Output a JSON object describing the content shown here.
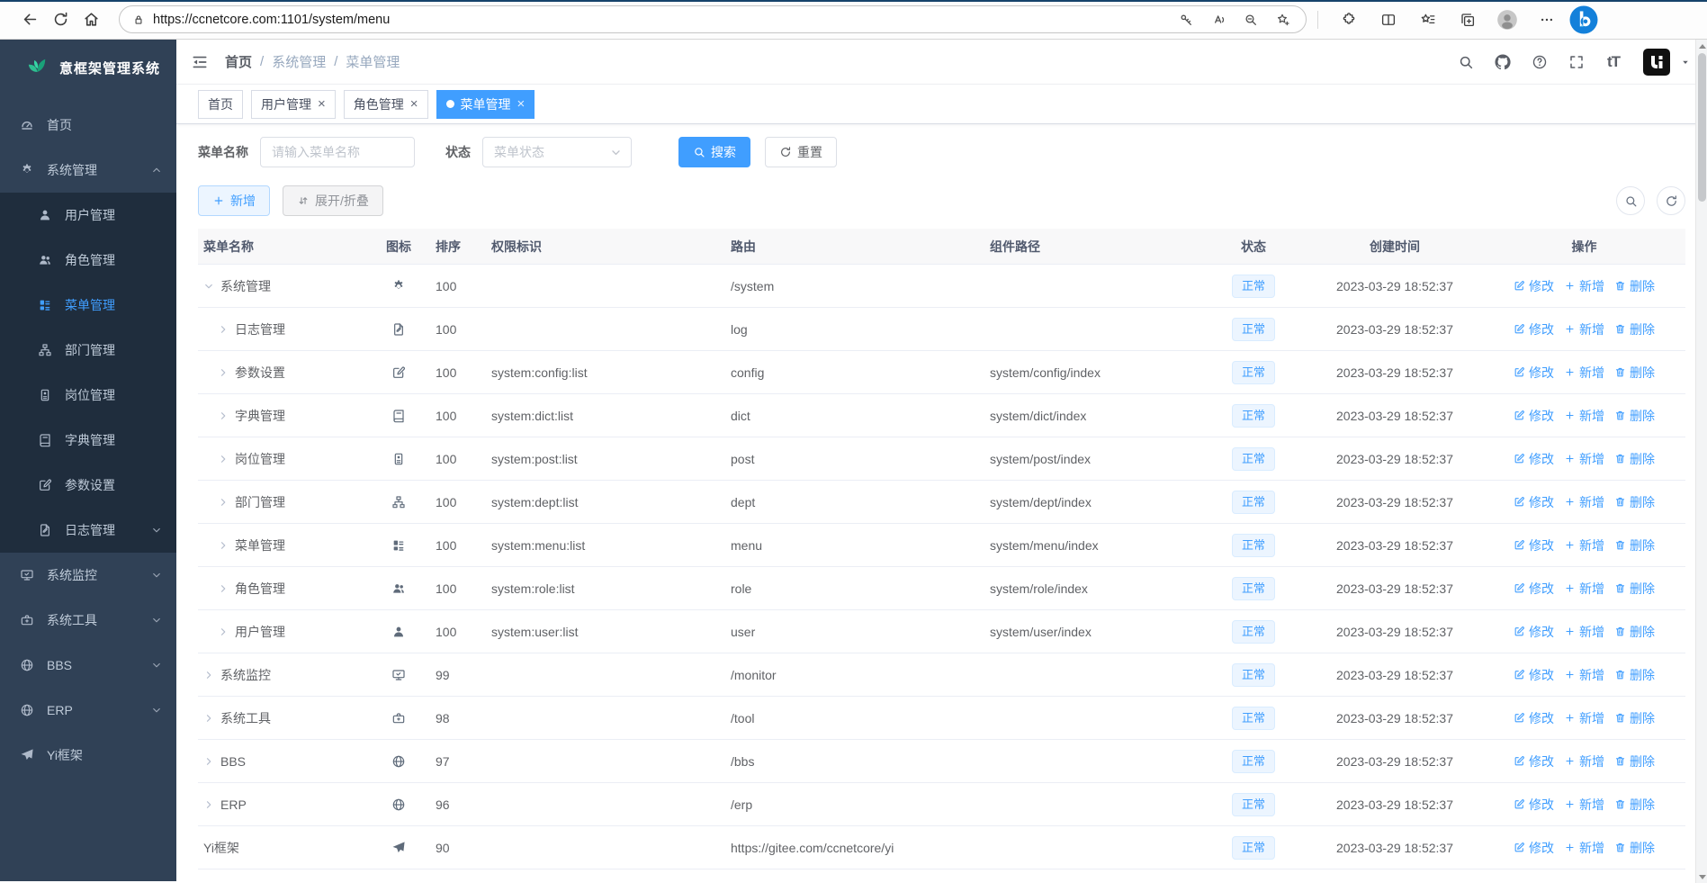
{
  "colors": {
    "accent": "#409eff",
    "sidebar_bg": "#304156",
    "submenu_bg": "#1f2d3d",
    "status_tag_bg": "#ecf5ff",
    "status_tag_text": "#409eff",
    "active_tab_bg": "#409eff"
  },
  "browser": {
    "url": "https://ccnetcore.com:1101/system/menu"
  },
  "navbar": {
    "font_size_glyph": "tT"
  },
  "app": {
    "logo_title": "意框架管理系统",
    "sidebar": {
      "items": [
        {
          "label": "首页",
          "icon": "i-dash"
        },
        {
          "label": "系统管理",
          "icon": "i-gear",
          "chevron": "up"
        },
        {
          "label": "用户管理",
          "icon": "i-user",
          "sub": true
        },
        {
          "label": "角色管理",
          "icon": "i-users",
          "sub": true
        },
        {
          "label": "菜单管理",
          "icon": "i-menu",
          "sub": true,
          "active": true
        },
        {
          "label": "部门管理",
          "icon": "i-tree",
          "sub": true
        },
        {
          "label": "岗位管理",
          "icon": "i-badge",
          "sub": true
        },
        {
          "label": "字典管理",
          "icon": "i-book",
          "sub": true
        },
        {
          "label": "参数设置",
          "icon": "i-pen",
          "sub": true
        },
        {
          "label": "日志管理",
          "icon": "i-doc",
          "sub": true,
          "chevron": "down"
        },
        {
          "label": "系统监控",
          "icon": "i-monitor",
          "chevron": "down"
        },
        {
          "label": "系统工具",
          "icon": "i-tool",
          "chevron": "down"
        },
        {
          "label": "BBS",
          "icon": "i-globe",
          "chevron": "down"
        },
        {
          "label": "ERP",
          "icon": "i-globe",
          "chevron": "down"
        },
        {
          "label": "Yi框架",
          "icon": "i-send"
        }
      ]
    },
    "breadcrumb": {
      "items": [
        "首页",
        "系统管理",
        "菜单管理"
      ],
      "separator": "/"
    },
    "tabs": [
      {
        "label": "首页",
        "closable": false
      },
      {
        "label": "用户管理",
        "closable": true
      },
      {
        "label": "角色管理",
        "closable": true
      },
      {
        "label": "菜单管理",
        "closable": true,
        "active": true
      }
    ],
    "search": {
      "name_label": "菜单名称",
      "name_placeholder": "请输入菜单名称",
      "status_label": "状态",
      "status_placeholder": "菜单状态",
      "search_button": "搜索",
      "reset_button": "重置"
    },
    "toolbar": {
      "add_button": "新增",
      "expand_button": "展开/折叠"
    },
    "table": {
      "headers": [
        "菜单名称",
        "图标",
        "排序",
        "权限标识",
        "路由",
        "组件路径",
        "状态",
        "创建时间",
        "操作"
      ],
      "ops": {
        "edit": "修改",
        "add": "新增",
        "delete": "删除"
      },
      "rows": [
        {
          "name": "系统管理",
          "icon": "i-gear",
          "sort": 100,
          "perm": "",
          "route": "/system",
          "component": "",
          "status": "正常",
          "created": "2023-03-29 18:52:37",
          "level": 0,
          "expand": "down"
        },
        {
          "name": "日志管理",
          "icon": "i-doc",
          "sort": 100,
          "perm": "",
          "route": "log",
          "component": "",
          "status": "正常",
          "created": "2023-03-29 18:52:37",
          "level": 1,
          "expand": "right"
        },
        {
          "name": "参数设置",
          "icon": "i-pen",
          "sort": 100,
          "perm": "system:config:list",
          "route": "config",
          "component": "system/config/index",
          "status": "正常",
          "created": "2023-03-29 18:52:37",
          "level": 1,
          "expand": "right"
        },
        {
          "name": "字典管理",
          "icon": "i-book",
          "sort": 100,
          "perm": "system:dict:list",
          "route": "dict",
          "component": "system/dict/index",
          "status": "正常",
          "created": "2023-03-29 18:52:37",
          "level": 1,
          "expand": "right"
        },
        {
          "name": "岗位管理",
          "icon": "i-badge",
          "sort": 100,
          "perm": "system:post:list",
          "route": "post",
          "component": "system/post/index",
          "status": "正常",
          "created": "2023-03-29 18:52:37",
          "level": 1,
          "expand": "right"
        },
        {
          "name": "部门管理",
          "icon": "i-tree",
          "sort": 100,
          "perm": "system:dept:list",
          "route": "dept",
          "component": "system/dept/index",
          "status": "正常",
          "created": "2023-03-29 18:52:37",
          "level": 1,
          "expand": "right"
        },
        {
          "name": "菜单管理",
          "icon": "i-menu",
          "sort": 100,
          "perm": "system:menu:list",
          "route": "menu",
          "component": "system/menu/index",
          "status": "正常",
          "created": "2023-03-29 18:52:37",
          "level": 1,
          "expand": "right"
        },
        {
          "name": "角色管理",
          "icon": "i-users",
          "sort": 100,
          "perm": "system:role:list",
          "route": "role",
          "component": "system/role/index",
          "status": "正常",
          "created": "2023-03-29 18:52:37",
          "level": 1,
          "expand": "right"
        },
        {
          "name": "用户管理",
          "icon": "i-user",
          "sort": 100,
          "perm": "system:user:list",
          "route": "user",
          "component": "system/user/index",
          "status": "正常",
          "created": "2023-03-29 18:52:37",
          "level": 1,
          "expand": "right"
        },
        {
          "name": "系统监控",
          "icon": "i-monitor",
          "sort": 99,
          "perm": "",
          "route": "/monitor",
          "component": "",
          "status": "正常",
          "created": "2023-03-29 18:52:37",
          "level": 0,
          "expand": "right"
        },
        {
          "name": "系统工具",
          "icon": "i-tool",
          "sort": 98,
          "perm": "",
          "route": "/tool",
          "component": "",
          "status": "正常",
          "created": "2023-03-29 18:52:37",
          "level": 0,
          "expand": "right"
        },
        {
          "name": "BBS",
          "icon": "i-globe",
          "sort": 97,
          "perm": "",
          "route": "/bbs",
          "component": "",
          "status": "正常",
          "created": "2023-03-29 18:52:37",
          "level": 0,
          "expand": "right"
        },
        {
          "name": "ERP",
          "icon": "i-globe",
          "sort": 96,
          "perm": "",
          "route": "/erp",
          "component": "",
          "status": "正常",
          "created": "2023-03-29 18:52:37",
          "level": 0,
          "expand": "right"
        },
        {
          "name": "Yi框架",
          "icon": "i-send",
          "sort": 90,
          "perm": "",
          "route": "https://gitee.com/ccnetcore/yi",
          "component": "",
          "status": "正常",
          "created": "2023-03-29 18:52:37",
          "level": 0,
          "expand": "none"
        }
      ]
    }
  }
}
